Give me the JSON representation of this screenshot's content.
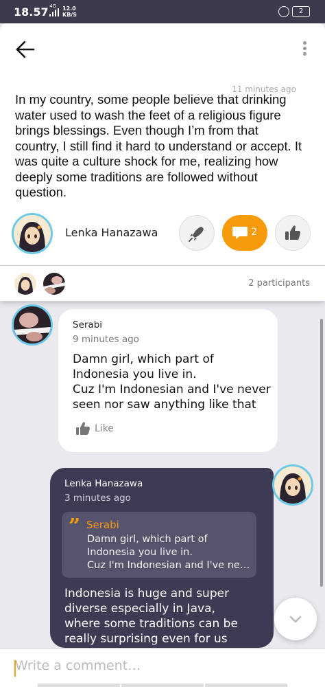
{
  "status_bar": {
    "time": "18.57",
    "network": "4G",
    "speed_value": "12.0",
    "speed_unit": "KB/S",
    "battery": "2"
  },
  "post": {
    "time": "11 minutes ago",
    "body": "In my country, some people believe that drinking water used to wash the feet of a religious figure brings blessings. Even though I’m from that country, I still find it hard to understand or accept. It was quite a culture shock for me, realizing how deeply some traditions are followed without question.",
    "author": "Lenka Hanazawa",
    "comment_count": "2",
    "participants_label": "2 participants"
  },
  "comments": [
    {
      "author": "Serabi",
      "time": "9 minutes ago",
      "text_lines": [
        "Damn girl, which part of",
        "Indonesia you live in.",
        "Cuz I'm Indonesian and I've never",
        "seen nor saw anything like that"
      ],
      "like_label": "Like"
    },
    {
      "author": "Lenka Hanazawa",
      "time": "3 minutes ago",
      "quote_author": "Serabi",
      "quote_lines": [
        "Damn girl, which part of",
        "Indonesia you live in.",
        "Cuz I'm Indonesian and I've ne…"
      ],
      "text_lines": [
        "Indonesia is huge and super",
        "diverse  especially in Java,",
        "where some traditions can be",
        "really surprising even for us"
      ]
    }
  ],
  "composer": {
    "placeholder": "Write a comment…"
  },
  "colors": {
    "accent": "#f79a0b",
    "dark_bubble": "#3d3b54",
    "status_bar": "#3c3a4d"
  }
}
